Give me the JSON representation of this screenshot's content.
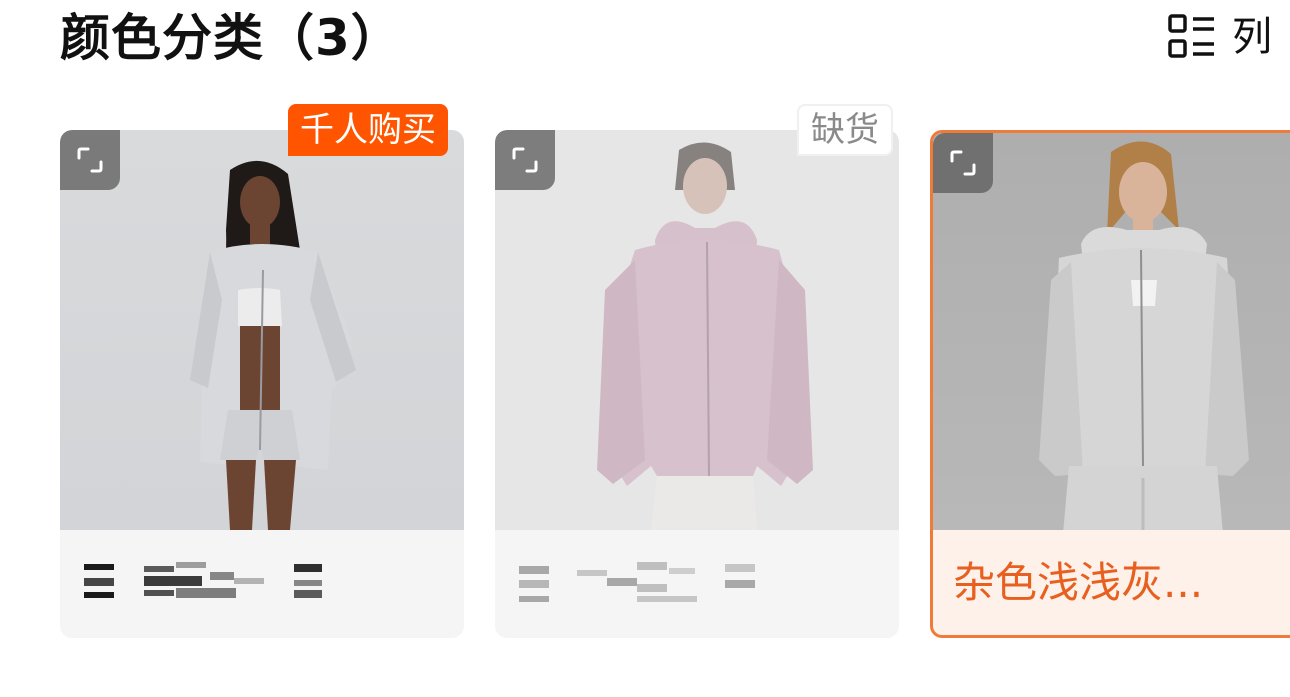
{
  "header": {
    "title": "颜色分类（3）",
    "view_toggle_icon": "list-view-icon",
    "view_toggle_label": "列"
  },
  "cards": [
    {
      "expand_icon": "expand-icon",
      "badge": "千人购买",
      "badge_color": "#ff5500",
      "state": "available"
    },
    {
      "expand_icon": "expand-icon",
      "badge": "缺货",
      "state": "out-of-stock"
    },
    {
      "expand_icon": "expand-icon",
      "color_name": "杂色浅浅灰...",
      "state": "selected",
      "accent_color": "#f07a3a"
    }
  ]
}
